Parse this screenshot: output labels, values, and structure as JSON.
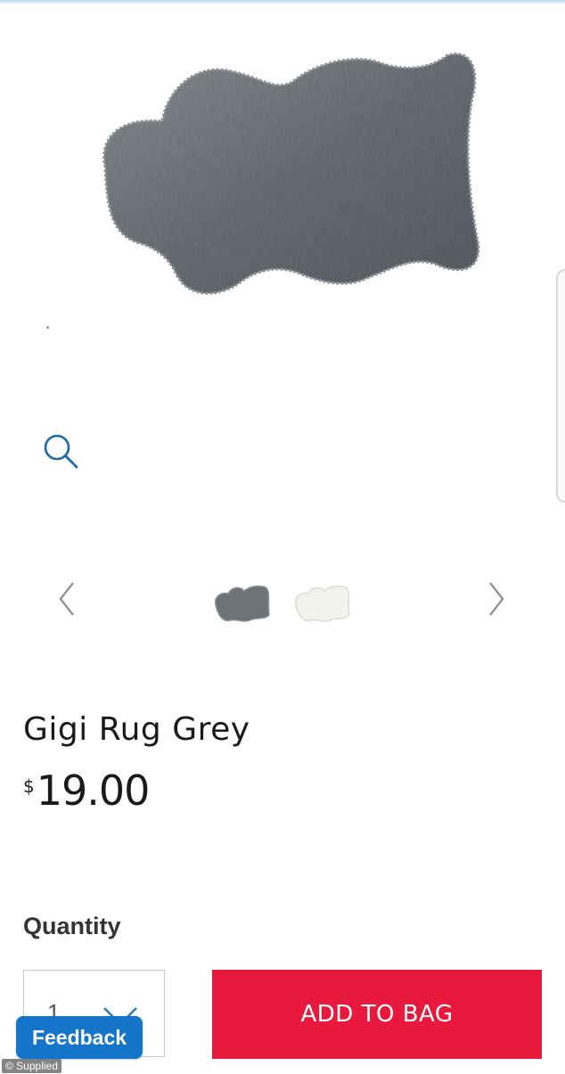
{
  "product": {
    "image_icon": "grey-faux-fur-rug",
    "title": "Gigi Rug Grey",
    "price_currency": "$",
    "price_amount": "19.00"
  },
  "gallery": {
    "zoom_icon": "search-icon",
    "prev_icon": "chevron-left-icon",
    "next_icon": "chevron-right-icon",
    "thumbnails": [
      {
        "variant": "grey",
        "color": "#6f7378"
      },
      {
        "variant": "white",
        "color": "#f1f1ec"
      }
    ]
  },
  "purchase": {
    "quantity_label": "Quantity",
    "quantity_value": "1",
    "add_to_bag_label": "ADD TO BAG"
  },
  "feedback": {
    "label": "Feedback"
  },
  "credit": {
    "label": "© Supplied"
  },
  "colors": {
    "accent": "#e8193c",
    "feedback": "#1575c8",
    "icon_blue": "#1b6aa6",
    "text": "#1a1a1a"
  }
}
